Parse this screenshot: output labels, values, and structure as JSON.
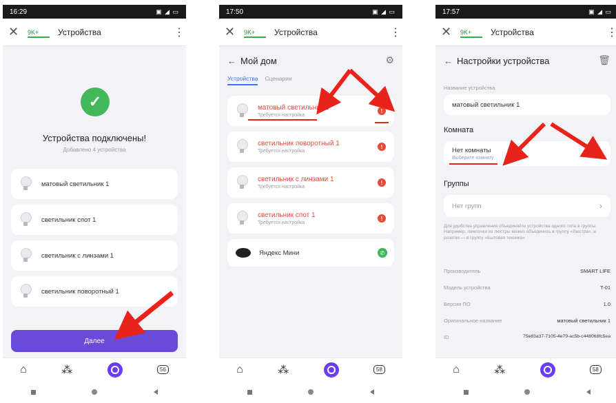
{
  "phones": [
    {
      "status_time": "16:29",
      "browser": {
        "rating": "9K+",
        "title": "Устройства"
      },
      "title": "Устройства подключены!",
      "subtitle": "Добавлено 4 устройства",
      "devices": [
        "матовый светильник 1",
        "светильник спот 1",
        "светильник с линзами 1",
        "светильник поворотный 1"
      ],
      "next_label": "Далее",
      "nav_badge": "56"
    },
    {
      "status_time": "17:50",
      "browser": {
        "rating": "9K+",
        "title": "Устройства"
      },
      "home_title": "Мой дом",
      "tabs": [
        "Устройства",
        "Сценарии"
      ],
      "devices": [
        {
          "name": "матовый светильник 1",
          "status": "Требуется настройка"
        },
        {
          "name": "светильник поворотный 1",
          "status": "Требуется настройка"
        },
        {
          "name": "светильник с линзами 1",
          "status": "Требуется настройка"
        },
        {
          "name": "светильник спот 1",
          "status": "Требуется настройка"
        }
      ],
      "speaker": "Яндекс Мини",
      "nav_badge": "58"
    },
    {
      "status_time": "17:57",
      "browser": {
        "rating": "9K+",
        "title": "Устройства"
      },
      "settings_title": "Настройки устройства",
      "name_label": "Название устройства",
      "name_value": "матовый светильник 1",
      "room_section": "Комната",
      "room_value": "Нет комнаты",
      "room_hint": "Выберите комнату",
      "groups_section": "Группы",
      "groups_value": "Нет групп",
      "help": "Для удобства управления объединяйте устройства одного типа в группы. Например, лампочки из люстры можно объединить в группу «Люстра», а розетки — в группу «Бытовая техника»",
      "info": [
        {
          "k": "Производитель",
          "v": "SMART LIFE"
        },
        {
          "k": "Модель устройства",
          "v": "T-01"
        },
        {
          "k": "Версия ПО",
          "v": "1.0"
        },
        {
          "k": "Оригинальное название",
          "v": "матовый светильник 1"
        },
        {
          "k": "ID",
          "v": "75e83a37-7105-4e79-ac5b-c448068fc5ea"
        }
      ],
      "nav_badge": "58"
    }
  ],
  "colors": {
    "accent": "#6a4bd9",
    "error": "#e84a3a",
    "success": "#43b85a",
    "arrow": "#e8231a"
  }
}
